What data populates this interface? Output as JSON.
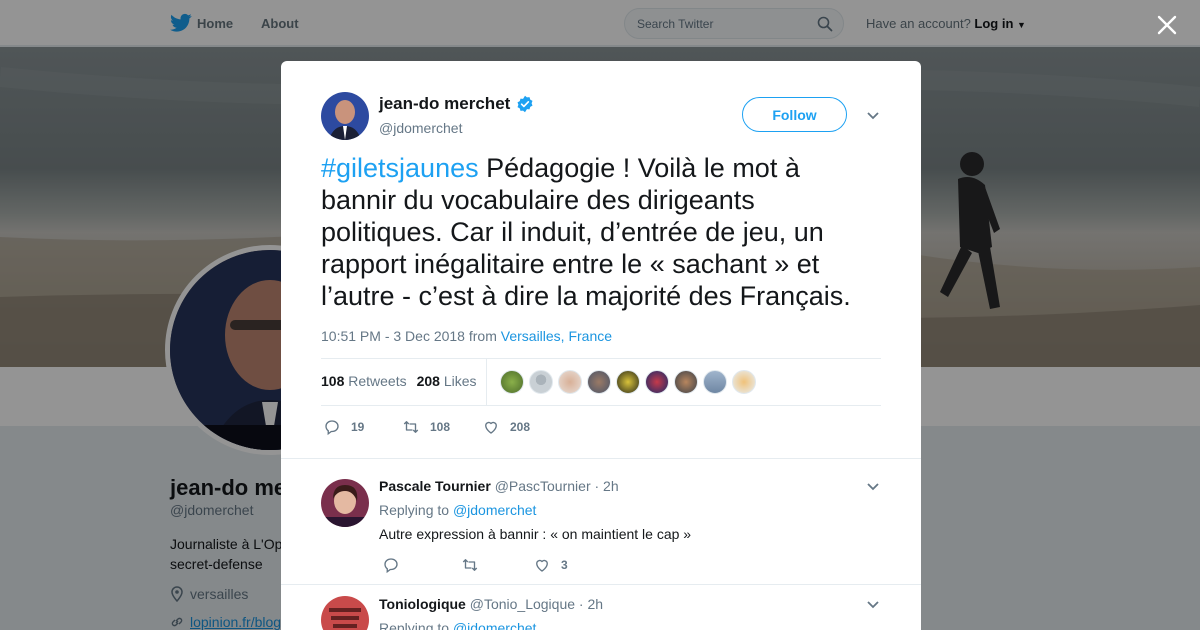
{
  "nav": {
    "home_label": "Home",
    "about_label": "About",
    "search_placeholder": "Search Twitter",
    "account_prompt": "Have an account?",
    "login_label": "Log in"
  },
  "background_profile": {
    "name": "jean-do me",
    "handle": "@jdomerchet",
    "bio": "Journaliste à L'Op secret-defense",
    "location": "versailles",
    "link": "lopinion.fr/blog"
  },
  "tweet": {
    "author_name": "jean-do merchet",
    "author_handle": "@jdomerchet",
    "follow_label": "Follow",
    "hashtag": "#giletsjaunes",
    "text": " Pédagogie ! Voilà le mot à bannir du vocabulaire des dirigeants politiques. Car il induit, d’entrée de jeu, un rapport inégalitaire entre le « sachant » et l’autre - c’est à dire la majorité des Français.",
    "timestamp": "10:51 PM - 3 Dec 2018 from",
    "location": "Versailles, France",
    "retweets_count": "108",
    "retweets_label": "Retweets",
    "likes_count": "208",
    "likes_label": "Likes",
    "reply_count": "19",
    "retweet_action_count": "108",
    "like_action_count": "208"
  },
  "replies": [
    {
      "name": "Pascale Tournier",
      "handle": "@PascTournier",
      "time": "· 2h",
      "replying_to_label": "Replying to",
      "replying_to_handle": "@jdomerchet",
      "text": "Autre expression à bannir : « on maintient le cap »",
      "like_count": "3"
    },
    {
      "name": "Toniologique",
      "handle": "@Tonio_Logique",
      "time": "· 2h",
      "replying_to_label": "Replying to",
      "replying_to_handle": "@jdomerchet"
    }
  ],
  "colors": {
    "brand": "#1da1f2",
    "link": "#1b95e0",
    "text": "#14171a",
    "muted": "#657786"
  }
}
